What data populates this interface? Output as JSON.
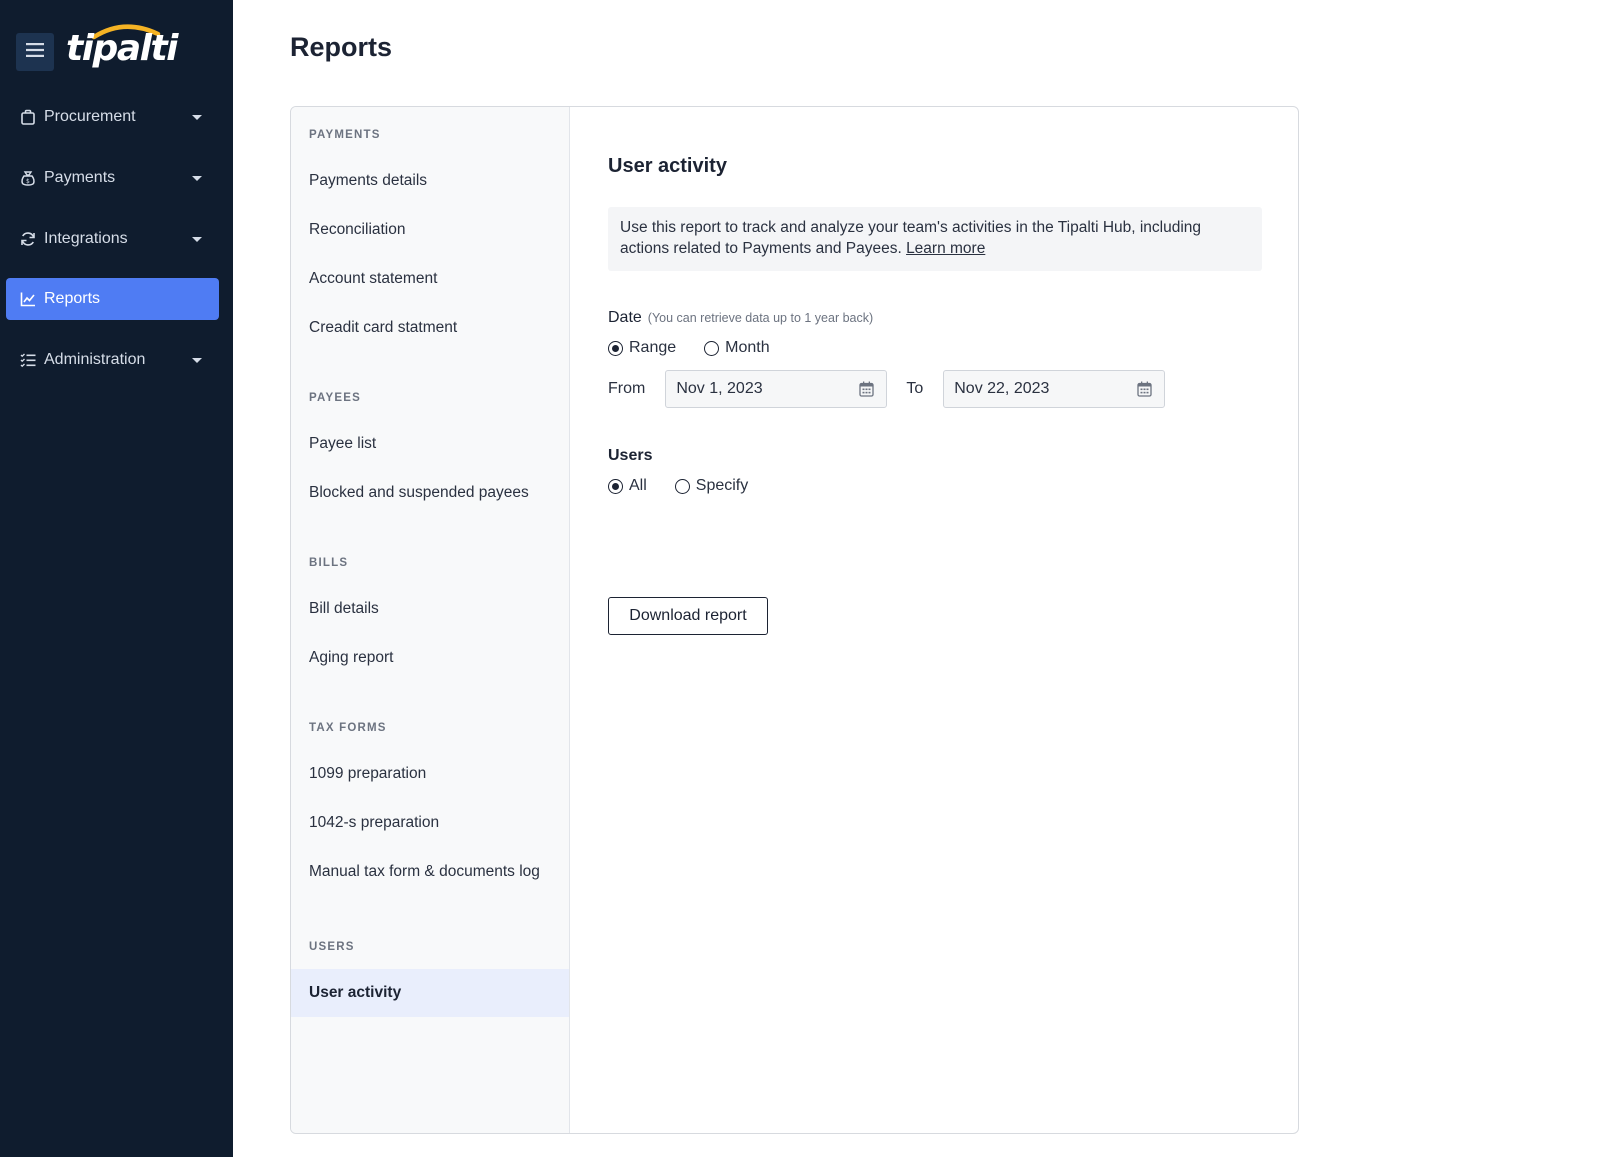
{
  "app": {
    "logo_text": "tipalti",
    "logo_accent_color": "#f5b324",
    "sidebar_bg": "#0f1c2e",
    "active_color": "#4f7cf3"
  },
  "sidebar": {
    "menu_icon": "hamburger-icon",
    "items": [
      {
        "label": "Procurement",
        "icon": "bag-icon",
        "expandable": true
      },
      {
        "label": "Payments",
        "icon": "money-bag-icon",
        "expandable": true
      },
      {
        "label": "Integrations",
        "icon": "sync-icon",
        "expandable": true
      },
      {
        "label": "Reports",
        "icon": "chart-icon",
        "expandable": false,
        "active": true
      },
      {
        "label": "Administration",
        "icon": "checklist-icon",
        "expandable": true
      }
    ]
  },
  "page": {
    "title": "Reports"
  },
  "report_menu": {
    "sections": [
      {
        "header": "PAYMENTS",
        "items": [
          "Payments details",
          "Reconciliation",
          "Account statement",
          "Creadit card statment"
        ]
      },
      {
        "header": "PAYEES",
        "items": [
          "Payee list",
          "Blocked and suspended payees"
        ]
      },
      {
        "header": "BILLS",
        "items": [
          "Bill details",
          "Aging report"
        ]
      },
      {
        "header": "TAX FORMS",
        "items": [
          "1099 preparation",
          "1042-s preparation",
          "Manual tax form & documents log"
        ]
      },
      {
        "header": "USERS",
        "items": [
          "User activity"
        ]
      }
    ],
    "selected": "User activity"
  },
  "detail": {
    "title": "User activity",
    "description": "Use this report to track and analyze your team's activities in the Tipalti Hub, including actions related to Payments and Payees.",
    "learn_more": "Learn more",
    "date_label": "Date",
    "date_hint": "(You can retrieve data up to 1 year back)",
    "date_mode_options": [
      "Range",
      "Month"
    ],
    "date_mode_selected": "Range",
    "from_label": "From",
    "from_value": "Nov 1, 2023",
    "to_label": "To",
    "to_value": "Nov 22, 2023",
    "users_label": "Users",
    "users_options": [
      "All",
      "Specify"
    ],
    "users_selected": "All",
    "download_button": "Download report"
  }
}
